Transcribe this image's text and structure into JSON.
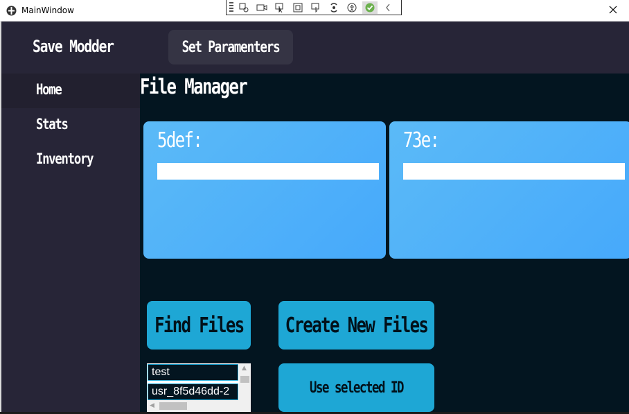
{
  "window": {
    "title": "MainWindow"
  },
  "header": {
    "app_name": "Save Modder",
    "set_params_label": "Set Paramenters"
  },
  "sidebar": {
    "items": [
      {
        "label": "Home",
        "active": true
      },
      {
        "label": "Stats",
        "active": false
      },
      {
        "label": "Inventory",
        "active": false
      }
    ]
  },
  "main": {
    "title": "File Manager",
    "cards": [
      {
        "label": "5def:",
        "value": ""
      },
      {
        "label": "73e:",
        "value": ""
      }
    ],
    "buttons": {
      "find_files": "Find Files",
      "create_new_files": "Create New Files",
      "use_selected_id": "Use selected ID"
    },
    "file_list": [
      "test",
      "usr_8f5d46dd-2"
    ]
  },
  "colors": {
    "sidebar_bg": "#272537",
    "main_bg": "#031520",
    "card_gradient_start": "#5bbaf7",
    "card_gradient_end": "#46a9fb",
    "button_bg": "#1ea7d5",
    "active_nav_bg": "#22202f"
  }
}
